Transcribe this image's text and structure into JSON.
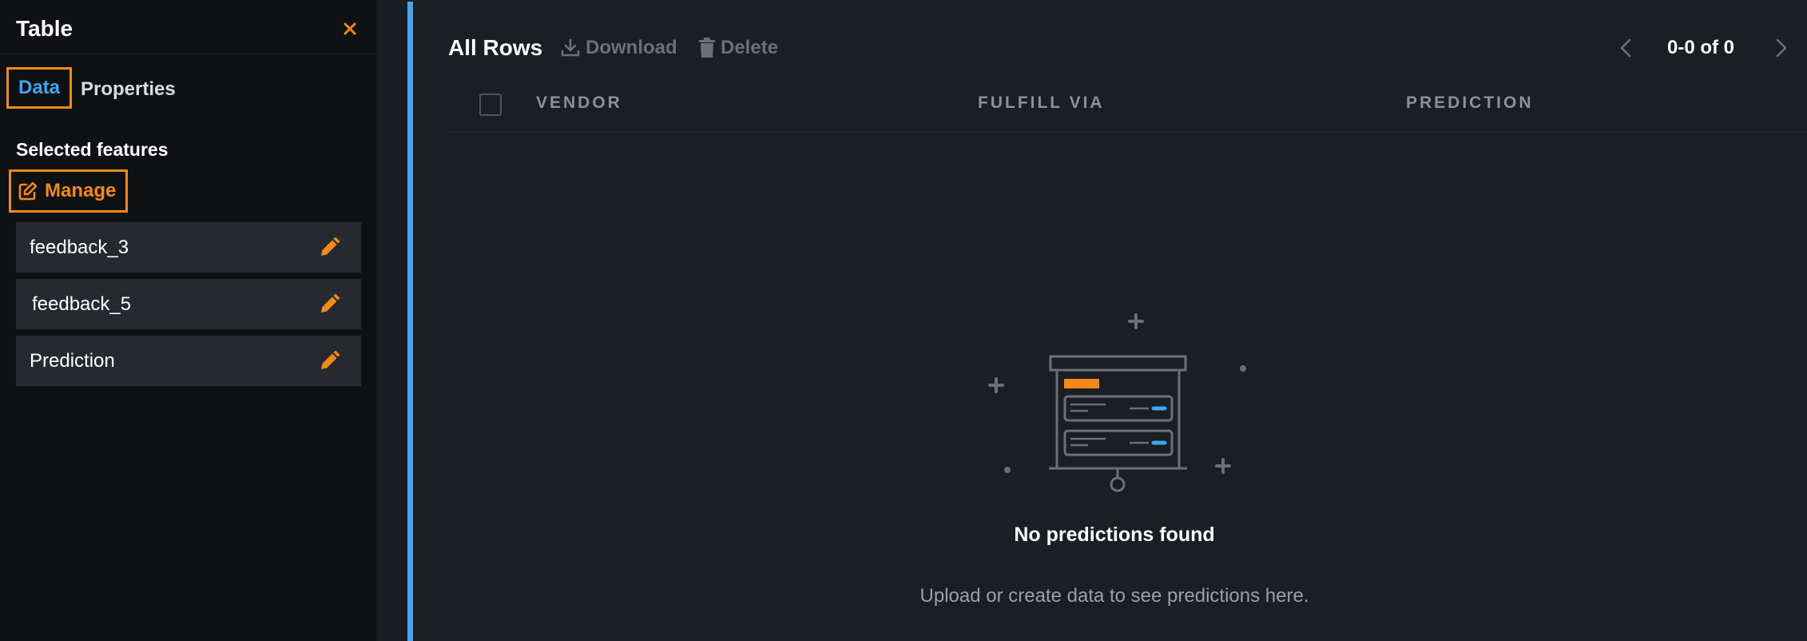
{
  "sidebar": {
    "title": "Table",
    "tabs": [
      {
        "label": "Data",
        "active": true
      },
      {
        "label": "Properties",
        "active": false
      }
    ],
    "section_label": "Selected features",
    "manage_label": "Manage",
    "features": [
      {
        "label": "feedback_3"
      },
      {
        "label": "feedback_5"
      },
      {
        "label": "Prediction"
      }
    ]
  },
  "main": {
    "title": "All Rows",
    "toolbar": {
      "download_label": "Download",
      "delete_label": "Delete"
    },
    "pagination": {
      "text": "0-0 of 0"
    },
    "columns": [
      "VENDOR",
      "FULFILL VIA",
      "PREDICTION"
    ],
    "empty_state": {
      "title": "No predictions found",
      "subtitle": "Upload or create data to see predictions here."
    }
  },
  "colors": {
    "accent_orange": "#f28a1a",
    "accent_blue": "#3ea6f0",
    "divider_blue": "#4aa3e8"
  },
  "icons": [
    "close-icon",
    "edit-square-icon",
    "pencil-icon",
    "download-icon",
    "trash-icon",
    "chevron-left-icon",
    "chevron-right-icon",
    "empty-predictions-illustration"
  ]
}
